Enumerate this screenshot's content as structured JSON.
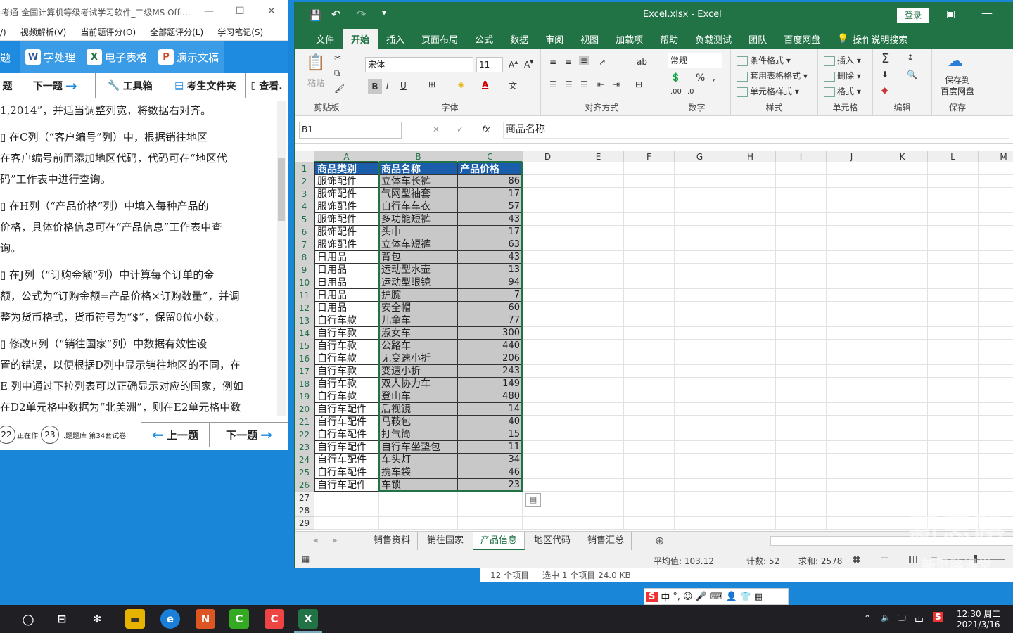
{
  "exam": {
    "title": "考通-全国计算机等级考试学习软件_二级MS Offi...",
    "menu": [
      "/)",
      "视频解析(V)",
      "当前题评分(O)",
      "全部题评分(L)",
      "学习笔记(S)"
    ],
    "apps": [
      "题",
      "字处理",
      "电子表格",
      "演示文稿"
    ],
    "app_badges": [
      "W",
      "X",
      "P"
    ],
    "tools": [
      "题",
      "下一题",
      "工具箱",
      "考生文件夹",
      "查看."
    ],
    "paragraphs": [
      [
        "1,2014”，并适当调整列宽，将数据右对齐。"
      ],
      [
        "  ▯ 在C列（“客户编号”列）中，根据销往地区",
        "在客户编号前面添加地区代码，代码可在“地区代",
        "码”工作表中进行查询。"
      ],
      [
        "  ▯ 在H列（“产品价格”列）中填入每种产品的",
        "价格，具体价格信息可在“产品信息”工作表中查",
        "询。"
      ],
      [
        "  ▯ 在J列（“订购金额”列）中计算每个订单的金",
        "额，公式为“订购金额=产品价格×订购数量”，并调",
        "整为货币格式，货币符号为“$”，保留0位小数。"
      ],
      [
        "  ▯ 修改E列（“销往国家”列）中数据有效性设",
        "置的错误，以便根据D列中显示销往地区的不同，在",
        "E 列中通过下拉列表可以正确显示对应的国家，例如",
        "在D2单元格中数据为“北美洲”，则在E2单元格中数"
      ]
    ],
    "circle_a": "22",
    "circle_b": "23",
    "footer_note": "正在作",
    "footer_info": ".题题库 第34套试卷",
    "prev_label": "上一题",
    "next_label": "下一题"
  },
  "excel": {
    "title": "Excel.xlsx  -  Excel",
    "login": "登录",
    "tabs": [
      "文件",
      "开始",
      "插入",
      "页面布局",
      "公式",
      "数据",
      "审阅",
      "视图",
      "加载项",
      "帮助",
      "负载测试",
      "团队",
      "百度网盘",
      "操作说明搜索"
    ],
    "groups": {
      "clipboard": "剪贴板",
      "font": "字体",
      "align": "对齐方式",
      "number": "数字",
      "styles": "样式",
      "cells": "单元格",
      "edit": "编辑",
      "save": "保存"
    },
    "paste": "粘贴",
    "font_name": "宋体",
    "font_size": "11",
    "num_format": "常规",
    "style_items": [
      "条件格式",
      "套用表格格式",
      "单元格样式"
    ],
    "cell_items": [
      "插入",
      "删除",
      "格式"
    ],
    "save_items": [
      "保存到",
      "百度网盘"
    ],
    "name_box": "B1",
    "formula": "商品名称",
    "columns": [
      "A",
      "B",
      "C",
      "D",
      "E",
      "F",
      "G",
      "H",
      "I",
      "J",
      "K",
      "L",
      "M"
    ],
    "header": [
      "商品类别",
      "商品名称",
      "产品价格"
    ],
    "rows": [
      [
        "服饰配件",
        "立体车长裤",
        "86"
      ],
      [
        "服饰配件",
        "气网型袖套",
        "17"
      ],
      [
        "服饰配件",
        "自行车车衣",
        "57"
      ],
      [
        "服饰配件",
        "多功能短裤",
        "43"
      ],
      [
        "服饰配件",
        "头巾",
        "17"
      ],
      [
        "服饰配件",
        "立体车短裤",
        "63"
      ],
      [
        "日用品",
        "背包",
        "43"
      ],
      [
        "日用品",
        "运动型水壶",
        "13"
      ],
      [
        "日用品",
        "运动型眼镜",
        "94"
      ],
      [
        "日用品",
        "护腕",
        "7"
      ],
      [
        "日用品",
        "安全帽",
        "60"
      ],
      [
        "自行车款",
        "儿童车",
        "77"
      ],
      [
        "自行车款",
        "淑女车",
        "300"
      ],
      [
        "自行车款",
        "公路车",
        "440"
      ],
      [
        "自行车款",
        "无变速小折",
        "206"
      ],
      [
        "自行车款",
        "变速小折",
        "243"
      ],
      [
        "自行车款",
        "双人协力车",
        "149"
      ],
      [
        "自行车款",
        "登山车",
        "480"
      ],
      [
        "自行车配件",
        "后视镜",
        "14"
      ],
      [
        "自行车配件",
        "马鞍包",
        "40"
      ],
      [
        "自行车配件",
        "打气筒",
        "15"
      ],
      [
        "自行车配件",
        "自行车坐垫包",
        "11"
      ],
      [
        "自行车配件",
        "车头灯",
        "34"
      ],
      [
        "自行车配件",
        "携车袋",
        "46"
      ],
      [
        "自行车配件",
        "车锁",
        "23"
      ]
    ],
    "row_numbers": [
      "1",
      "2",
      "3",
      "4",
      "5",
      "6",
      "7",
      "8",
      "9",
      "10",
      "11",
      "12",
      "13",
      "14",
      "15",
      "16",
      "17",
      "18",
      "19",
      "20",
      "21",
      "22",
      "23",
      "24",
      "25",
      "26",
      "27",
      "28",
      "29"
    ],
    "sheets": [
      "销售资料",
      "销往国家",
      "产品信息",
      "地区代码",
      "销售汇总"
    ],
    "active_sheet": "产品信息",
    "status": {
      "avg": "平均值: 103.12",
      "count": "计数: 52",
      "sum": "求和: 2578"
    }
  },
  "explorer": {
    "items": "12 个项目",
    "selected": "选中 1 个项目  24.0 KB"
  },
  "taskbar": {
    "time": "12:30 周二",
    "date": "2021/3/16",
    "ime": "中"
  },
  "watermark": {
    "main": "新思路",
    "sub": "新思路课堂"
  },
  "colors": {
    "excel_green": "#217346",
    "header_blue": "#1a5eab",
    "exam_blue": "#1e8be0"
  }
}
